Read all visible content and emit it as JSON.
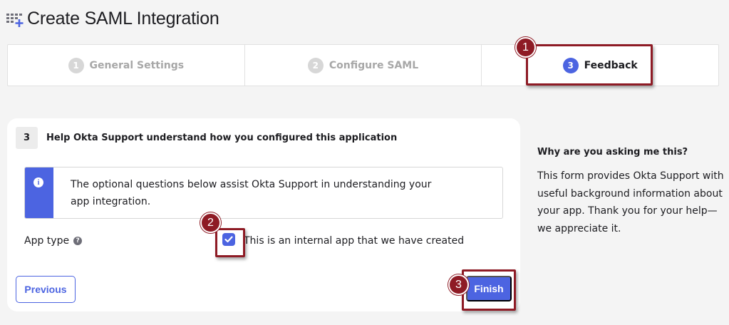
{
  "header": {
    "title": "Create SAML Integration",
    "icon": "app-grid-add-icon"
  },
  "stepper": {
    "steps": [
      {
        "number": "1",
        "label": "General Settings",
        "state": "inactive"
      },
      {
        "number": "2",
        "label": "Configure SAML",
        "state": "inactive"
      },
      {
        "number": "3",
        "label": "Feedback",
        "state": "active"
      }
    ]
  },
  "form": {
    "section_number": "3",
    "section_title": "Help Okta Support understand how you configured this application",
    "info_text": "The optional questions below assist Okta Support in understanding your app integration.",
    "app_type_label": "App type",
    "app_type_help_icon": "question-circle-icon",
    "internal_app_checkbox_label": "This is an internal app that we have created",
    "internal_app_checked": true,
    "previous_label": "Previous",
    "finish_label": "Finish"
  },
  "side_help": {
    "title": "Why are you asking me this?",
    "text": "This form provides Okta Support with useful background information about your app. Thank you for your help—we appreciate it."
  },
  "annotations": [
    {
      "number": "1",
      "target": "Feedback step"
    },
    {
      "number": "2",
      "target": "internal app checkbox"
    },
    {
      "number": "3",
      "target": "Finish button"
    }
  ],
  "colors": {
    "accent": "#4c64e1",
    "annotation": "#8e1b25",
    "background": "#f4f4f4"
  }
}
